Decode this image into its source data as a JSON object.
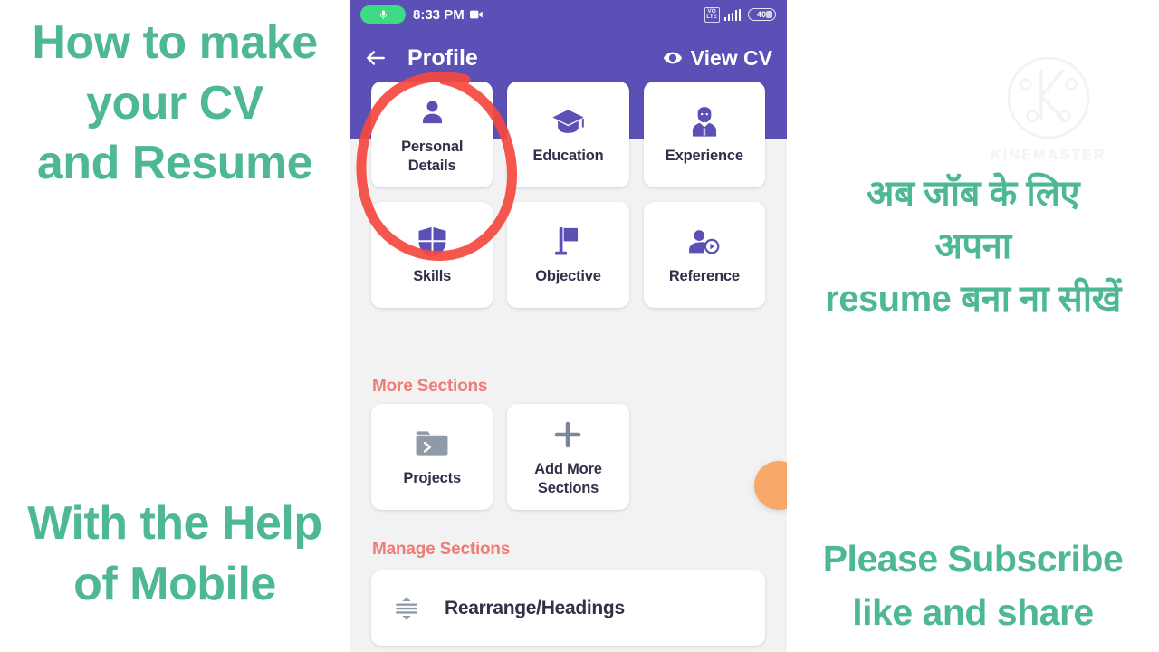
{
  "colors": {
    "brand_purple": "#5a50b5",
    "caption_green": "#4db892",
    "section_head_red": "#ef7c75",
    "card_text": "#2e3148",
    "fab_orange": "#f6a96a",
    "annotation_red": "#f4483f",
    "screen_bg": "#f2f2f2",
    "mic_green": "#3ddc84"
  },
  "captions": {
    "top_left": "How to make\nyour CV\nand Resume",
    "bottom_left": "With the Help\nof Mobile",
    "top_right": "अब जॉब के लिए\nअपना\nresume बना ना सीखें",
    "bottom_right": "Please Subscribe\nlike and share"
  },
  "watermark": {
    "text": "KINEMASTER",
    "logo_icon": "kinemaster-k-logo"
  },
  "phone": {
    "status_bar": {
      "mic_icon": "microphone-icon",
      "time": "8:33 PM",
      "recording_icon": "video-camera-icon",
      "network_label": "VO LTE",
      "network_line1": "VO",
      "network_line2": "LTE",
      "signal_icon": "signal-bars-icon",
      "battery_level": "40"
    },
    "app_bar": {
      "back_icon": "back-arrow-icon",
      "title": "Profile",
      "view_cv_icon": "eye-icon",
      "view_cv_label": "View CV"
    },
    "main_sections": [
      {
        "label": "Personal\nDetails",
        "icon": "person-icon"
      },
      {
        "label": "Education",
        "icon": "graduation-cap-icon"
      },
      {
        "label": "Experience",
        "icon": "businessman-icon"
      },
      {
        "label": "Skills",
        "icon": "shield-icon"
      },
      {
        "label": "Objective",
        "icon": "flag-icon"
      },
      {
        "label": "Reference",
        "icon": "person-arrow-icon"
      }
    ],
    "more_sections": {
      "heading": "More Sections",
      "items": [
        {
          "label": "Projects",
          "icon": "folder-icon"
        },
        {
          "label": "Add More\nSections",
          "icon": "plus-icon"
        }
      ]
    },
    "manage_sections": {
      "heading": "Manage Sections",
      "rearrange_label": "Rearrange/Headings",
      "rearrange_icon": "sort-reorder-icon"
    },
    "fab": {
      "icon": "floating-action-button"
    }
  },
  "annotation": {
    "shape": "hand-drawn-red-circle",
    "target": "Personal Details"
  }
}
